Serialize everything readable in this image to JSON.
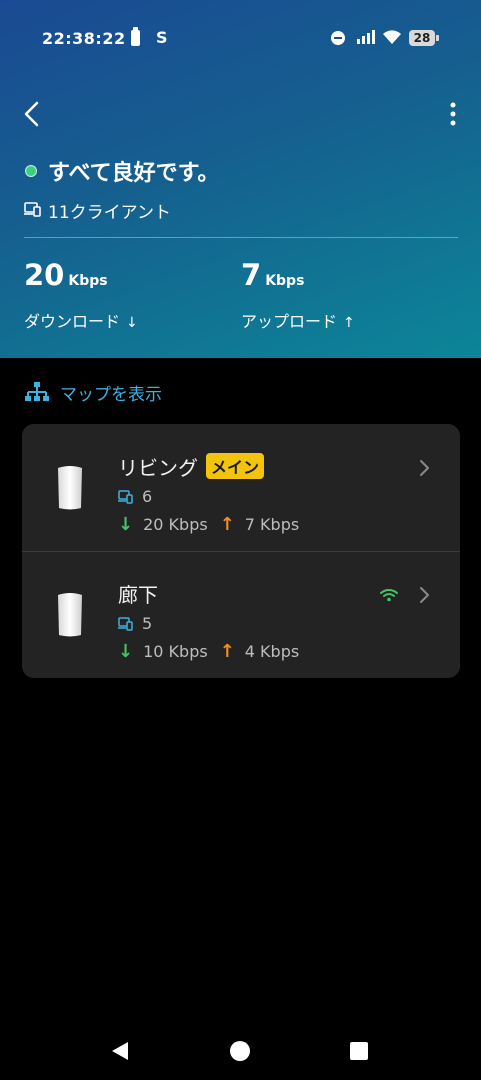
{
  "status_bar": {
    "time": "22:38:22",
    "extra_icon_text": "S",
    "battery_level": "28"
  },
  "header": {
    "status_text": "すべて良好です。",
    "clients_text": "11クライアント",
    "download": {
      "value": "20",
      "unit": "Kbps",
      "label": "ダウンロード",
      "arrow": "↓"
    },
    "upload": {
      "value": "7",
      "unit": "Kbps",
      "label": "アップロード",
      "arrow": "↑"
    }
  },
  "map_link": {
    "label": "マップを表示"
  },
  "devices": [
    {
      "name": "リビング",
      "badge": "メイン",
      "clients": "6",
      "download": "20 Kbps",
      "upload": "7 Kbps"
    },
    {
      "name": "廊下",
      "clients": "5",
      "download": "10 Kbps",
      "upload": "4 Kbps"
    }
  ],
  "colors": {
    "accent": "#3fb1df",
    "status_ok": "#3ccf7d",
    "badge": "#f2c40e",
    "download": "#45c466",
    "upload": "#f08e23"
  }
}
